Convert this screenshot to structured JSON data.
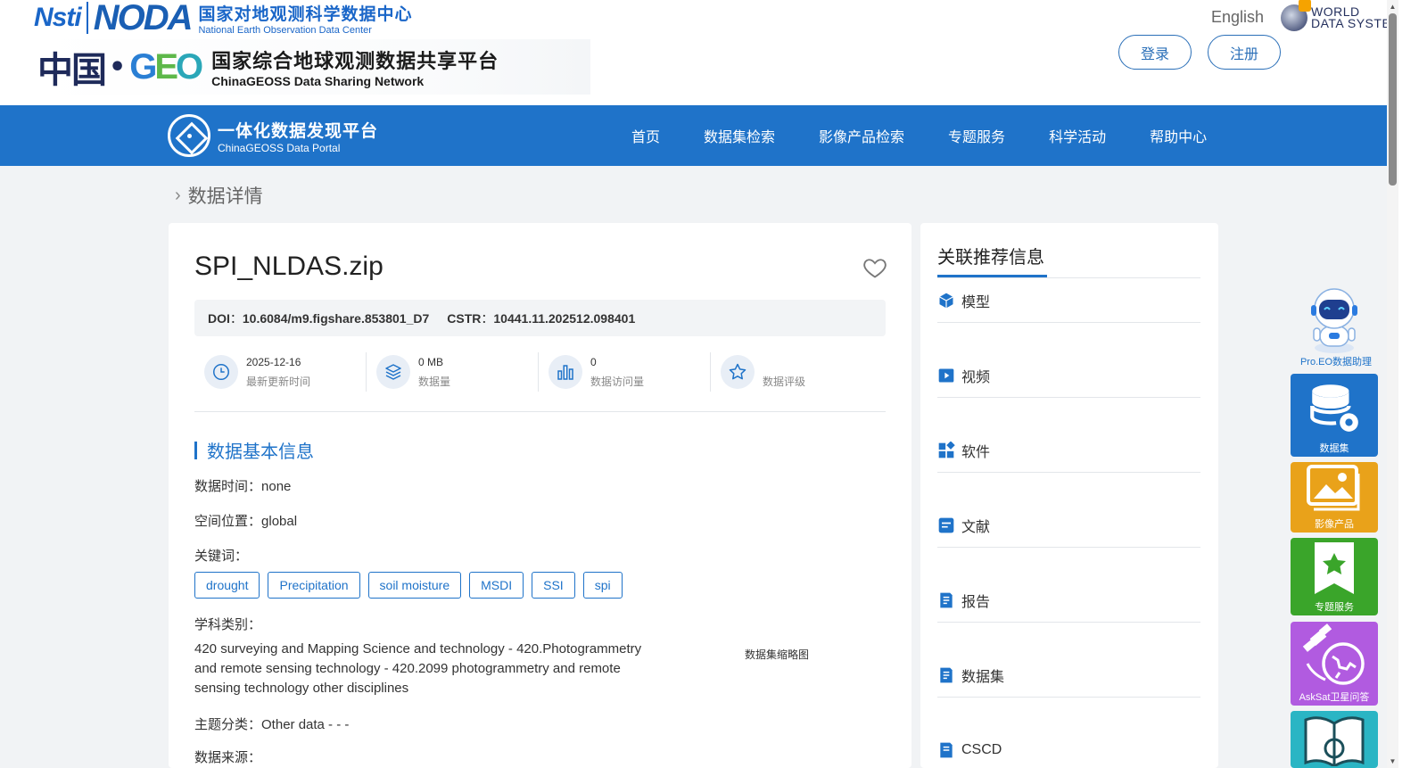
{
  "header": {
    "nsti_logo": "Nsti",
    "noda_logo": "NODA",
    "noda_cn": "国家对地观测科学数据中心",
    "noda_en": "National Earth Observation Data Center",
    "china_logo": "中国",
    "geo_logo": "GEO",
    "geoss_cn": "国家综合地球观测数据共享平台",
    "geoss_en": "ChinaGEOSS Data Sharing Network",
    "language": "English",
    "wds_line1": "WORLD",
    "wds_line2": "DATA SYSTEM",
    "login_label": "登录",
    "register_label": "注册"
  },
  "nav": {
    "portal_cn": "一体化数据发现平台",
    "portal_en": "ChinaGEOSS Data Portal",
    "items": [
      "首页",
      "数据集检索",
      "影像产品检索",
      "专题服务",
      "科学活动",
      "帮助中心"
    ],
    "accent_color": "#1f73c9"
  },
  "breadcrumb": {
    "current": "数据详情"
  },
  "dataset": {
    "title": "SPI_NLDAS.zip",
    "doi_label": "DOI",
    "doi_value": "10.6084/m9.figshare.853801_D7",
    "cstr_label": "CSTR",
    "cstr_value": "10441.11.202512.098401",
    "stats": [
      {
        "value": "2025-12-16",
        "label": "最新更新时间",
        "icon": "clock-icon"
      },
      {
        "value": "0 MB",
        "label": "数据量",
        "icon": "layers-icon"
      },
      {
        "value": "0",
        "label": "数据访问量",
        "icon": "bar-chart-icon"
      },
      {
        "value": "",
        "label": "数据评级",
        "icon": "star-icon"
      }
    ],
    "section_title": "数据基本信息",
    "data_time_label": "数据时间：",
    "data_time_value": "none",
    "location_label": "空间位置：",
    "location_value": "global",
    "keywords_label": "关键词：",
    "keywords": [
      "drought",
      "Precipitation",
      "soil moisture",
      "MSDI",
      "SSI",
      "spi"
    ],
    "subject_label": "学科类别：",
    "subject_value": "420 surveying and Mapping Science and technology - 420.Photogrammetry and remote sensing technology - 420.2099 photogrammetry and remote sensing technology other disciplines",
    "topic_label": "主题分类：",
    "topic_value": "Other data - - -",
    "partial_field": "数据来源：",
    "thumbnail_label": "数据集缩略图"
  },
  "related": {
    "title": "关联推荐信息",
    "items": [
      {
        "label": "模型",
        "icon": "cube-icon"
      },
      {
        "label": "视频",
        "icon": "video-icon"
      },
      {
        "label": "软件",
        "icon": "apps-icon"
      },
      {
        "label": "文献",
        "icon": "document-icon"
      },
      {
        "label": "报告",
        "icon": "report-icon"
      },
      {
        "label": "数据集",
        "icon": "dataset-icon"
      },
      {
        "label": "CSCD",
        "icon": "cscd-icon"
      }
    ]
  },
  "floating": {
    "assistant_label": "Pro.EO数据助理",
    "buttons": [
      {
        "label": "数据集",
        "icon": "database-icon",
        "color": "#1f73c9"
      },
      {
        "label": "影像产品",
        "icon": "image-icon",
        "color": "#e9a21a"
      },
      {
        "label": "专题服务",
        "icon": "bookmark-star-icon",
        "color": "#3aa52a"
      },
      {
        "label": "AskSat卫星问答",
        "icon": "satellite-icon",
        "color": "#b15be0"
      },
      {
        "label": "",
        "icon": "book-icon",
        "color": "#2ab5c4"
      }
    ]
  }
}
